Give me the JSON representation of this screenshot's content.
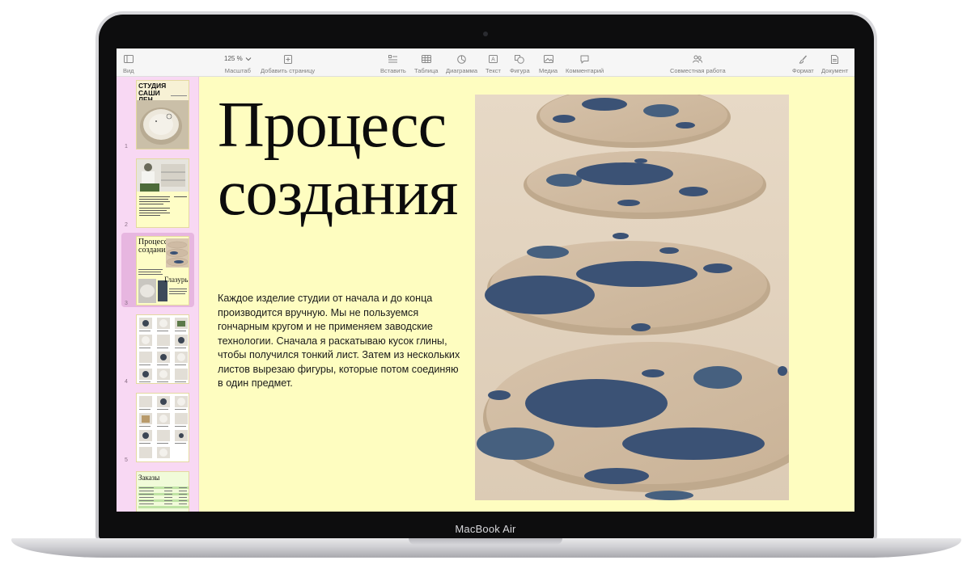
{
  "device": {
    "brand": "MacBook Air"
  },
  "toolbar": {
    "view": "Вид",
    "zoom_value": "125 %",
    "zoom": "Масштаб",
    "add_page": "Добавить страницу",
    "insert": "Вставить",
    "table": "Таблица",
    "chart": "Диаграмма",
    "text": "Текст",
    "shape": "Фигура",
    "media": "Медиа",
    "comment": "Комментарий",
    "collaborate": "Совместная работа",
    "format": "Формат",
    "document": "Документ"
  },
  "sidebar": {
    "pages": [
      {
        "num": "1",
        "title": "СТУДИЯ САШИ ЛЕН"
      },
      {
        "num": "2",
        "title": ""
      },
      {
        "num": "3",
        "title": "Процесс создания",
        "subtitle": "Глазурь"
      },
      {
        "num": "4",
        "title": ""
      },
      {
        "num": "5",
        "title": ""
      },
      {
        "num": "",
        "title": "Заказы"
      }
    ],
    "selected_index": 3
  },
  "page": {
    "title_line1": "Процесс",
    "title_line2": "создания",
    "body": "Каждое изделие студии от начала и до конца производится вручную. Мы не пользуемся гончарным кругом и не применяем заводские технологии. Сначала я раскатываю кусок глины, чтобы получился тонкий лист. Затем из нескольких листов вырезаю фигуры, которые потом соединяю в один предмет."
  },
  "colors": {
    "page_background": "#fefdc0",
    "sidebar_background": "#f8d8f3",
    "selected_thumb": "#e7b6e0",
    "clay": "#d8c3ad",
    "glaze": "#3b5275"
  }
}
